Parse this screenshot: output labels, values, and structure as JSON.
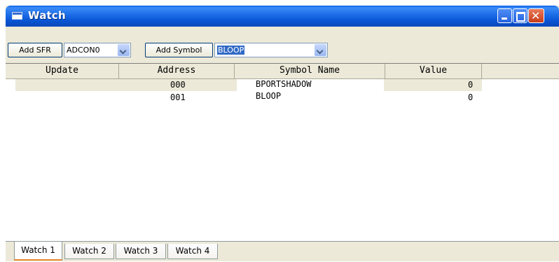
{
  "window": {
    "title": "Watch"
  },
  "toolbar": {
    "add_sfr_label": "Add SFR",
    "sfr_select_value": "ADCON0",
    "add_symbol_label": "Add Symbol",
    "symbol_select_value": "BLOOP"
  },
  "table": {
    "columns": [
      "Update",
      "Address",
      "Symbol Name",
      "Value"
    ],
    "rows": [
      {
        "update": "",
        "address": "000",
        "symbol": "BPORTSHADOW",
        "value": "0"
      },
      {
        "update": "",
        "address": "001",
        "symbol": "BLOOP",
        "value": "0"
      }
    ]
  },
  "tabs": [
    "Watch 1",
    "Watch 2",
    "Watch 3",
    "Watch 4"
  ],
  "active_tab": "Watch 1",
  "icons": {
    "window_icon": "window-icon",
    "minimize": "minimize-icon",
    "maximize": "maximize-icon",
    "close": "close-icon",
    "dropdown": "chevron-down-icon"
  }
}
